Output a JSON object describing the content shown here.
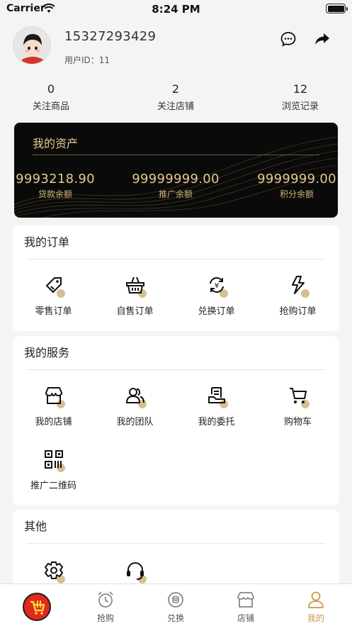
{
  "status_bar": {
    "carrier": "Carrier",
    "time": "8:24 PM"
  },
  "profile": {
    "phone": "15327293429",
    "uid_label": "用户ID：",
    "uid": "11"
  },
  "stats": [
    {
      "value": "0",
      "label": "关注商品"
    },
    {
      "value": "2",
      "label": "关注店铺"
    },
    {
      "value": "12",
      "label": "浏览记录"
    }
  ],
  "assets": {
    "title": "我的资产",
    "items": [
      {
        "value": "9993218.90",
        "label": "贷款余额"
      },
      {
        "value": "99999999.00",
        "label": "推广余额"
      },
      {
        "value": "9999999.00",
        "label": "积分余额"
      }
    ]
  },
  "orders": {
    "title": "我的订单",
    "items": [
      {
        "label": "零售订单",
        "icon": "tag-icon"
      },
      {
        "label": "自售订单",
        "icon": "basket-icon"
      },
      {
        "label": "兑换订单",
        "icon": "exchange-icon"
      },
      {
        "label": "抢购订单",
        "icon": "lightning-icon"
      }
    ]
  },
  "services": {
    "title": "我的服务",
    "items": [
      {
        "label": "我的店铺",
        "icon": "store-icon"
      },
      {
        "label": "我的团队",
        "icon": "team-icon"
      },
      {
        "label": "我的委托",
        "icon": "delegate-icon"
      },
      {
        "label": "购物车",
        "icon": "cart-icon"
      },
      {
        "label": "推广二维码",
        "icon": "qrcode-icon"
      }
    ]
  },
  "others": {
    "title": "其他",
    "items": [
      {
        "label": "",
        "icon": "settings-icon"
      },
      {
        "label": "",
        "icon": "headset-icon"
      }
    ]
  },
  "tabbar": {
    "items": [
      {
        "label": "",
        "icon": "shop-logo-icon"
      },
      {
        "label": "抢购",
        "icon": "alarm-clock-icon"
      },
      {
        "label": "兑换",
        "icon": "exchange-coin-icon"
      },
      {
        "label": "店铺",
        "icon": "store-tab-icon"
      },
      {
        "label": "我的",
        "icon": "user-icon",
        "active": true
      }
    ]
  },
  "colors": {
    "gold": "#e7c98f",
    "accent_dot": "#d8bf92",
    "active_tab": "#c69a4f",
    "logo_red": "#e02a1d"
  }
}
